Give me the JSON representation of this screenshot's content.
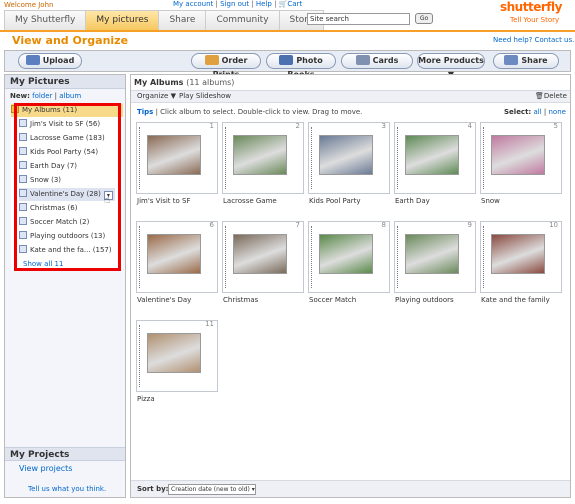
{
  "header": {
    "welcome": "Welcome John",
    "links": [
      "My account",
      "Sign out",
      "Help",
      "Cart"
    ],
    "tabs": [
      "My Shutterfly",
      "My pictures",
      "Share",
      "Community",
      "Store"
    ],
    "active_tab": "My pictures",
    "search_value": "Site search",
    "go_label": "Go",
    "logo_name": "shutterfly",
    "logo_tagline": "Tell Your Story"
  },
  "page": {
    "title": "View and Organize",
    "help_link": "Need help? Contact us."
  },
  "toolbar": {
    "upload": "Upload",
    "order_prints": "Order Prints",
    "photo_books": "Photo Books",
    "cards": "Cards",
    "more_products": "More Products ▼",
    "share": "Share"
  },
  "sidebar": {
    "title": "My Pictures",
    "new_label": "New:",
    "new_folder": "folder",
    "new_album": "album",
    "tree": [
      "My Albums (11)",
      "Jim's Visit to SF (56)",
      "Lacrosse Game (183)",
      "Kids Pool Party (54)",
      "Earth Day (7)",
      "Snow (3)",
      "Valentine's Day (28)",
      "Christmas (6)",
      "Soccer Match (2)",
      "Playing outdoors (13)",
      "Kate and the fa... (157)"
    ],
    "show_all": "Show all 11",
    "projects_title": "My Projects",
    "view_projects": "View projects",
    "tell_us": "Tell us what you think."
  },
  "main": {
    "title": "My Albums",
    "count": "(11 albums)",
    "organize": "Organize ▼",
    "play_slideshow": "Play Slideshow",
    "delete": "Delete",
    "tips_label": "Tips",
    "tips_text": "Click album to select. Double-click to view. Drag to move.",
    "select_label": "Select:",
    "select_all": "all",
    "select_none": "none",
    "albums": [
      {
        "num": "1",
        "label": "Jim's Visit to SF",
        "color": "#8a6a55"
      },
      {
        "num": "2",
        "label": "Lacrosse Game",
        "color": "#6a8a5a"
      },
      {
        "num": "3",
        "label": "Kids Pool Party",
        "color": "#6a7a95"
      },
      {
        "num": "4",
        "label": "Earth Day",
        "color": "#5f8a55"
      },
      {
        "num": "5",
        "label": "Snow",
        "color": "#c07aa0"
      },
      {
        "num": "6",
        "label": "Valentine's Day",
        "color": "#9a6a48"
      },
      {
        "num": "7",
        "label": "Christmas",
        "color": "#7a6a5a"
      },
      {
        "num": "8",
        "label": "Soccer Match",
        "color": "#5a8a4a"
      },
      {
        "num": "9",
        "label": "Playing outdoors",
        "color": "#6a8a5a"
      },
      {
        "num": "10",
        "label": "Kate and the family",
        "color": "#8a4a40"
      },
      {
        "num": "11",
        "label": "Pizza",
        "color": "#b09070"
      }
    ],
    "sort_label": "Sort by:",
    "sort_value": "Creation date (new to old)"
  },
  "colors": {
    "accent_orange": "#f7a028",
    "link_blue": "#0066cc",
    "highlight_red": "#ee0000"
  }
}
